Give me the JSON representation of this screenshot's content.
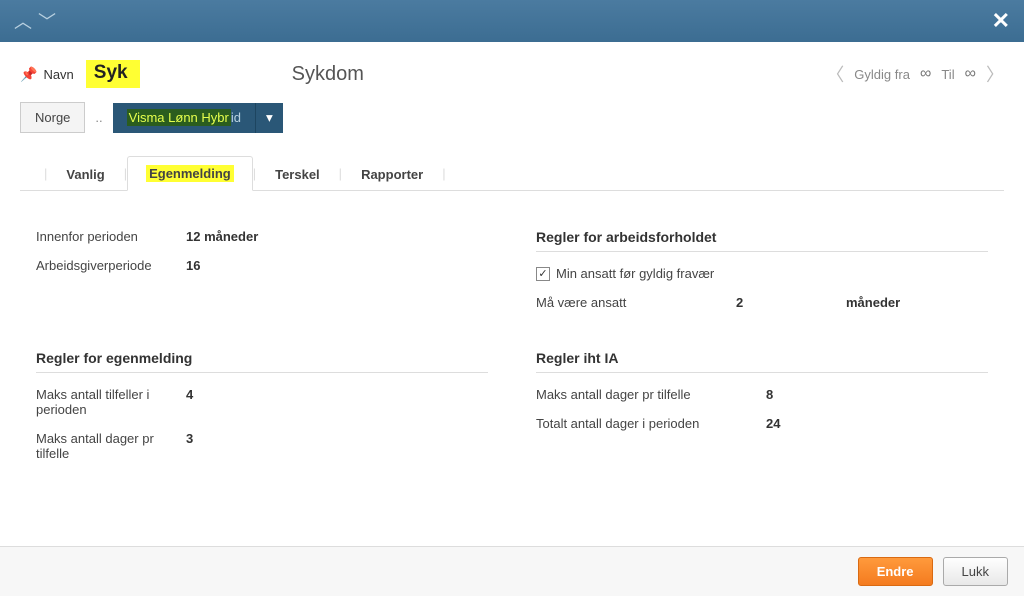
{
  "titlebar": {
    "up_label": "▲",
    "down_label": "▼",
    "close_label": "✕"
  },
  "header": {
    "navn_label": "Navn",
    "syk_text": "Syk",
    "title": "Sykdom",
    "gyldig_fra": "Gyldig fra",
    "infinity": "∞",
    "til": "Til",
    "norge_btn": "Norge",
    "hybrid_hl": "Visma Lønn Hybr",
    "hybrid_rest": "id"
  },
  "tabs": {
    "vanlig": "Vanlig",
    "egenmelding": "Egenmelding",
    "terskel": "Terskel",
    "rapporter": "Rapporter"
  },
  "content": {
    "periode": {
      "innenfor_label": "Innenfor perioden",
      "innenfor_value": "12 måneder",
      "arbeidsgiver_label": "Arbeidsgiverperiode",
      "arbeidsgiver_value": "16"
    },
    "arbeidsforhold": {
      "title": "Regler for arbeidsforholdet",
      "min_ansatt_label": "Min ansatt før gyldig fravær",
      "ma_vaere_label": "Må være ansatt",
      "ma_vaere_value": "2",
      "ma_vaere_unit": "måneder"
    },
    "egenmelding_rules": {
      "title": "Regler for egenmelding",
      "maks_tilfeller_label": "Maks antall tilfeller i perioden",
      "maks_tilfeller_value": "4",
      "maks_dager_label": "Maks antall dager pr tilfelle",
      "maks_dager_value": "3"
    },
    "ia_rules": {
      "title": "Regler iht IA",
      "maks_dager_label": "Maks antall dager pr tilfelle",
      "maks_dager_value": "8",
      "totalt_label": "Totalt antall dager i perioden",
      "totalt_value": "24"
    }
  },
  "footer": {
    "endre": "Endre",
    "lukk": "Lukk"
  }
}
